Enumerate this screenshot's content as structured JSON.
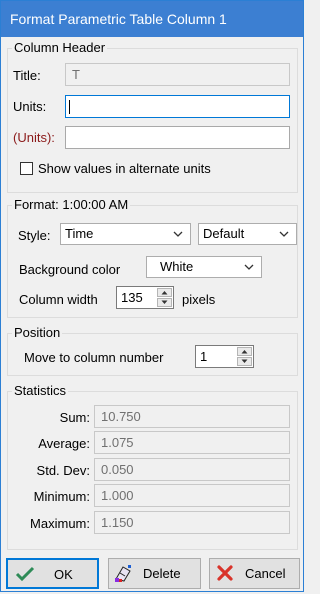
{
  "window": {
    "title": "Format Parametric Table Column 1"
  },
  "column_header": {
    "legend": "Column Header",
    "title_label": "Title:",
    "title_value": "T",
    "units_label": "Units:",
    "units_value": "",
    "alt_units_label": "(Units):",
    "alt_units_value": "",
    "show_alt_label": "Show values in alternate units",
    "show_alt_checked": false
  },
  "format": {
    "legend": "Format: 1:00:00 AM",
    "style_label": "Style:",
    "style_value": "Time",
    "style2_value": "Default",
    "bg_label": "Background color",
    "bg_value": "White",
    "width_label": "Column width",
    "width_value": "135",
    "width_unit": "pixels"
  },
  "position": {
    "legend": "Position",
    "move_label": "Move to column number",
    "move_value": "1"
  },
  "statistics": {
    "legend": "Statistics",
    "sum_label": "Sum:",
    "sum_value": "10.750",
    "avg_label": "Average:",
    "avg_value": "1.075",
    "std_label": "Std. Dev:",
    "std_value": "0.050",
    "min_label": "Minimum:",
    "min_value": "1.000",
    "max_label": "Maximum:",
    "max_value": "1.150"
  },
  "buttons": {
    "ok_label": "OK",
    "ok_icon": "checkmark-icon",
    "delete_label": "Delete",
    "delete_icon": "eraser-icon",
    "cancel_label": "Cancel",
    "cancel_icon": "x-icon"
  },
  "colors": {
    "titlebar": "#3c7fd2",
    "ok_check": "#2e8b57",
    "cancel_x": "#d9342b",
    "alt_units_label": "#8b1a1a"
  }
}
